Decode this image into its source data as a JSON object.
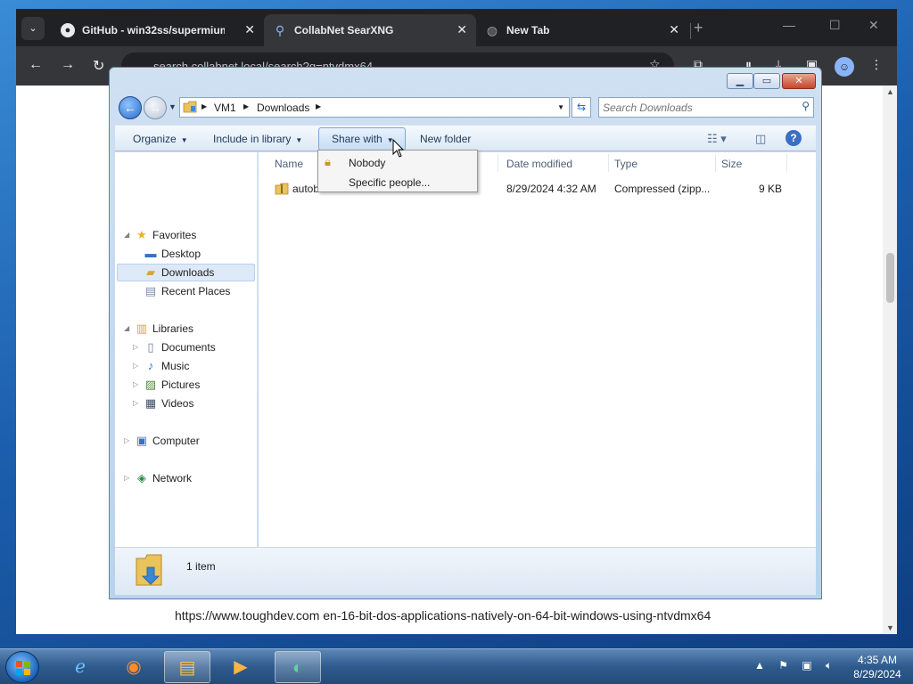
{
  "browser": {
    "tabs": [
      {
        "title": "GitHub - win32ss/supermium: ...",
        "active": false
      },
      {
        "title": "CollabNet SearXNG",
        "active": true
      },
      {
        "title": "New Tab",
        "active": false
      }
    ],
    "url": "search.collabnet.local/search?q=ntvdmx64",
    "status_url": "https://www.toughdev.com  en-16-bit-dos-applications-natively-on-64-bit-windows-using-ntvdmx64"
  },
  "explorer": {
    "breadcrumb": [
      "VM1",
      "Downloads"
    ],
    "search_placeholder": "Search Downloads",
    "commands": {
      "organize": "Organize",
      "include_in_library": "Include in library",
      "share_with": "Share with",
      "new_folder": "New folder"
    },
    "share_menu": {
      "nobody": "Nobody",
      "specific_people": "Specific people..."
    },
    "nav": {
      "favorites": "Favorites",
      "desktop": "Desktop",
      "downloads": "Downloads",
      "recent_places": "Recent Places",
      "libraries": "Libraries",
      "documents": "Documents",
      "music": "Music",
      "pictures": "Pictures",
      "videos": "Videos",
      "computer": "Computer",
      "network": "Network"
    },
    "columns": {
      "name": "Name",
      "date_modified": "Date modified",
      "type": "Type",
      "size": "Size"
    },
    "files": [
      {
        "name": "autob",
        "date_modified": "8/29/2024 4:32 AM",
        "type": "Compressed (zipp...",
        "size": "9 KB"
      }
    ],
    "details": {
      "count": "1 item"
    }
  },
  "taskbar": {
    "time": "4:35 AM",
    "date": "8/29/2024"
  },
  "colors": {
    "chrome_dark": "#202124",
    "chrome_tab": "#35363a",
    "aero_frame": "#bad2ec",
    "taskbar": "#2e5b8d"
  }
}
